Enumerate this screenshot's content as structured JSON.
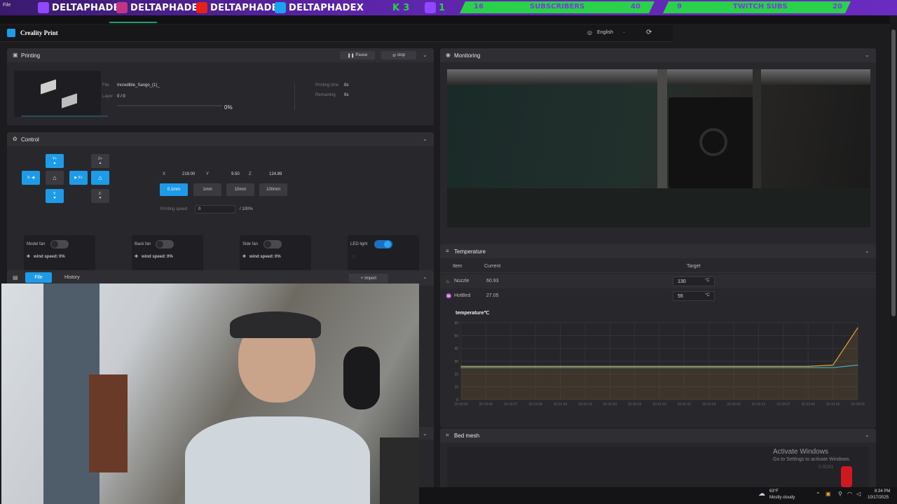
{
  "banner": {
    "handles": [
      "DELTAPHADE",
      "DELTAPHADE",
      "DELTAPHADE",
      "DELTAPHADEX"
    ],
    "k_label": "K",
    "k_count": "3",
    "t_count": "1",
    "stats": [
      {
        "count": "16",
        "label": "SUBSCRIBERS",
        "goal": "40"
      },
      {
        "count": "9",
        "label": "TWITCH SUBS",
        "goal": "20"
      }
    ],
    "menu_file": "File"
  },
  "titlebar": {
    "app_name": "Creality Print",
    "language": "English"
  },
  "printing": {
    "header": "Printing",
    "pause_label": "Pause",
    "stop_label": "stop",
    "file_label": "File",
    "file_value": "Incredible_Sango_(1)_",
    "layer_label": "Layer",
    "layer_value": "0 / 0",
    "progress": "0%",
    "progress_fraction": 0,
    "printing_time_label": "Printing time",
    "printing_time_value": "0s",
    "remaining_label": "Remaining",
    "remaining_value": "0s"
  },
  "control": {
    "header": "Control",
    "y_plus": "Y+",
    "y_minus": "Y-",
    "x_plus": "X+",
    "x_minus": "X-",
    "z_plus": "Z+",
    "z_minus": "Z-",
    "x_label": "X",
    "x_value": "219.00",
    "y_label": "Y",
    "y_value": "9.50",
    "z_label": "Z",
    "z_value": "124.89",
    "steps": [
      "0.1mm",
      "1mm",
      "10mm",
      "100mm"
    ],
    "printing_speed_label": "Printing speed",
    "printing_speed_value": "0",
    "printing_speed_pct": "/ 100%",
    "fans": [
      {
        "label": "Model fan",
        "speed_label": "wind speed:",
        "speed": "0%"
      },
      {
        "label": "Back fan",
        "speed_label": "wind speed:",
        "speed": "0%"
      },
      {
        "label": "Side fan",
        "speed_label": "wind speed:",
        "speed": "0%"
      }
    ],
    "led_label": "LED light"
  },
  "files": {
    "tab_file": "File",
    "tab_history": "History",
    "import_label": "Import"
  },
  "monitoring": {
    "header": "Monitoring"
  },
  "temperature": {
    "header": "Temperature",
    "col_item": "Item",
    "col_current": "Current",
    "col_target": "Target",
    "rows": [
      {
        "item": "Nozzle",
        "current": "60.93",
        "target": "130",
        "unit": "°C"
      },
      {
        "item": "HotBed",
        "current": "27.05",
        "target": "55",
        "unit": "°C"
      }
    ]
  },
  "bed_mesh": {
    "header": "Bed mesh"
  },
  "watermark": {
    "line1": "Activate Windows",
    "line2": "Go to Settings to activate Windows.",
    "faint": "0.9281"
  },
  "taskbar": {
    "weather_temp": "63°F",
    "weather_desc": "Mostly cloudy",
    "time": "8:34 PM",
    "date": "10/17/2025"
  },
  "chart_data": {
    "type": "line",
    "title": "temperature℃",
    "x": [
      "20:29:05",
      "20:29:46",
      "20:30:27",
      "20:31:08",
      "20:31:49",
      "20:32:14",
      "20:32:50",
      "20:30:26",
      "20:31:02",
      "20:31:41",
      "20:32:24",
      "20:32:53",
      "20:33:13",
      "20:33:27",
      "20:33:40",
      "20:33:56",
      "20:34:03"
    ],
    "ylim": [
      0,
      60
    ],
    "yticks": [
      0,
      10,
      20,
      30,
      40,
      50,
      60
    ],
    "grid": true,
    "series": [
      {
        "color": "#e8a23a",
        "values": [
          26,
          26,
          26,
          26,
          26,
          26,
          26,
          26,
          26,
          26,
          26,
          26,
          26,
          26,
          26,
          27,
          56
        ]
      },
      {
        "color": "#3ab0c8",
        "values": [
          25,
          25,
          25,
          25,
          25,
          25,
          25,
          25,
          25,
          25,
          25,
          25,
          25,
          25,
          25,
          25,
          27
        ]
      }
    ]
  },
  "colors": {
    "accent": "#1e9be8",
    "nozzle": "#e8a23a",
    "bed": "#3ab0c8",
    "banner_green": "#2ad14a"
  }
}
